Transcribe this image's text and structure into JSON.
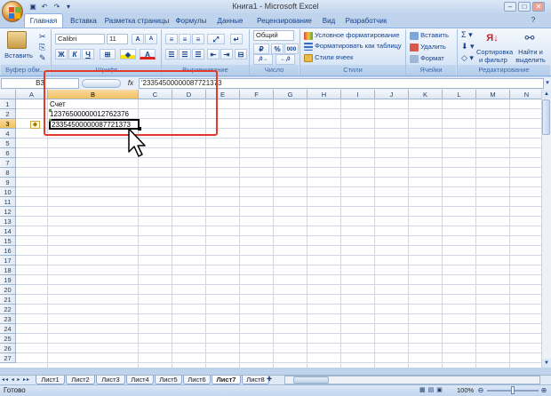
{
  "title": "Книга1 - Microsoft Excel",
  "tabs": [
    "Главная",
    "Вставка",
    "Разметка страницы",
    "Формулы",
    "Данные",
    "Рецензирование",
    "Вид",
    "Разработчик"
  ],
  "groups": {
    "clipboard": "Буфер обм...",
    "font": "Шрифт",
    "alignment": "Выравнивание",
    "number": "Число",
    "styles": "Стили",
    "cells": "Ячейки",
    "editing": "Редактирование"
  },
  "ribbon": {
    "paste": "Вставить",
    "font_name": "Calibri",
    "font_size": "11",
    "bold": "Ж",
    "italic": "К",
    "underline": "Ч",
    "number_format": "Общий",
    "percent": "%",
    "thousands": "000",
    "cond_format": "Условное форматирование",
    "format_table": "Форматировать как таблицу",
    "cell_styles": "Стили ячеек",
    "insert": "Вставить",
    "delete": "Удалить",
    "format": "Формат",
    "sort_filter": "Сортировка\nи фильтр",
    "find_select": "Найти и\nвыделить"
  },
  "formula_bar": {
    "name_box": "B3",
    "fx": "fx",
    "content": "'23354500000087721373"
  },
  "columns": [
    "A",
    "B",
    "C",
    "D",
    "E",
    "F",
    "G",
    "H",
    "I",
    "J",
    "K",
    "L",
    "M",
    "N"
  ],
  "rows": [
    "1",
    "2",
    "3",
    "4",
    "5",
    "6",
    "7",
    "8",
    "9",
    "10",
    "11",
    "12",
    "13",
    "14",
    "15",
    "16",
    "17",
    "18",
    "19",
    "20",
    "21",
    "22",
    "23",
    "24",
    "25",
    "26",
    "27"
  ],
  "cells": {
    "B1": "Счет",
    "B2": "12376500000012762376",
    "B3": "23354500000087721373"
  },
  "sheets": [
    "Лист1",
    "Лист2",
    "Лист3",
    "Лист4",
    "Лист5",
    "Лист6",
    "Лист7",
    "Лист8"
  ],
  "active_sheet": "Лист7",
  "status": {
    "ready": "Готово",
    "zoom": "100%"
  },
  "colors": {
    "annotation": "#e23b2e",
    "selection": "#000000"
  }
}
